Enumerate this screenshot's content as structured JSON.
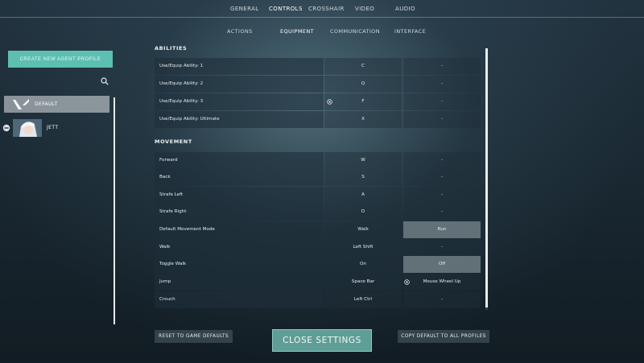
{
  "nav": {
    "tabs": [
      {
        "label": "GENERAL"
      },
      {
        "label": "CONTROLS"
      },
      {
        "label": "CROSSHAIR"
      },
      {
        "label": "VIDEO"
      },
      {
        "label": "AUDIO"
      }
    ],
    "subtabs": [
      {
        "label": "ACTIONS"
      },
      {
        "label": "EQUIPMENT"
      },
      {
        "label": "COMMUNICATION"
      },
      {
        "label": "INTERFACE"
      }
    ]
  },
  "profiles": {
    "create_label": "CREATE NEW AGENT PROFILE",
    "items": [
      {
        "name": "DEFAULT",
        "icon": "valorant-logo-icon"
      },
      {
        "name": "JETT",
        "icon": "agent-portrait-icon"
      }
    ]
  },
  "sections": {
    "abilities": {
      "title": "ABILITIES",
      "rows": [
        {
          "label": "Use/Equip Ability: 1",
          "primary": "C",
          "secondary": "-"
        },
        {
          "label": "Use/Equip Ability: 2",
          "primary": "Q",
          "secondary": "-"
        },
        {
          "label": "Use/Equip Ability: 3",
          "primary": "F",
          "secondary": "-"
        },
        {
          "label": "Use/Equip Ability: Ultimate",
          "primary": "X",
          "secondary": "-"
        }
      ]
    },
    "movement": {
      "title": "MOVEMENT",
      "rows": [
        {
          "label": "Forward",
          "primary": "W",
          "secondary": "-"
        },
        {
          "label": "Back",
          "primary": "S",
          "secondary": "-"
        },
        {
          "label": "Strafe Left",
          "primary": "A",
          "secondary": "-"
        },
        {
          "label": "Strafe Right",
          "primary": "D",
          "secondary": "-"
        },
        {
          "label": "Default Movement Mode",
          "primary": "Walk",
          "secondary": "Run"
        },
        {
          "label": "Walk",
          "primary": "Left Shift",
          "secondary": "-"
        },
        {
          "label": "Toggle Walk",
          "primary": "On",
          "secondary": "Off"
        },
        {
          "label": "Jump",
          "primary": "Space Bar",
          "secondary": "Mouse Wheel Up"
        },
        {
          "label": "Crouch",
          "primary": "Left Ctrl",
          "secondary": "-"
        }
      ]
    }
  },
  "buttons": {
    "reset": "RESET TO GAME DEFAULTS",
    "close": "CLOSE SETTINGS",
    "copy": "COPY DEFAULT TO ALL PROFILES"
  },
  "colors": {
    "accent": "#5dbfb2",
    "close_button": "#5f9e97",
    "highlight_cell": "#6e7d84"
  }
}
